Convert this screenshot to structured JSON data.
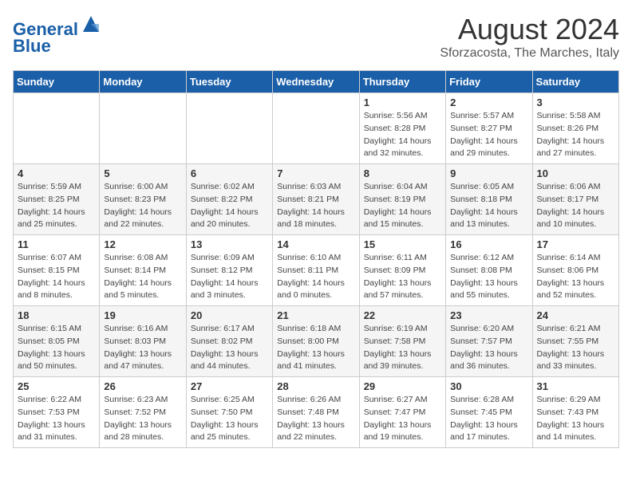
{
  "header": {
    "logo_line1": "General",
    "logo_line2": "Blue",
    "month": "August 2024",
    "location": "Sforzacosta, The Marches, Italy"
  },
  "weekdays": [
    "Sunday",
    "Monday",
    "Tuesday",
    "Wednesday",
    "Thursday",
    "Friday",
    "Saturday"
  ],
  "weeks": [
    [
      {
        "day": "",
        "info": ""
      },
      {
        "day": "",
        "info": ""
      },
      {
        "day": "",
        "info": ""
      },
      {
        "day": "",
        "info": ""
      },
      {
        "day": "1",
        "info": "Sunrise: 5:56 AM\nSunset: 8:28 PM\nDaylight: 14 hours\nand 32 minutes."
      },
      {
        "day": "2",
        "info": "Sunrise: 5:57 AM\nSunset: 8:27 PM\nDaylight: 14 hours\nand 29 minutes."
      },
      {
        "day": "3",
        "info": "Sunrise: 5:58 AM\nSunset: 8:26 PM\nDaylight: 14 hours\nand 27 minutes."
      }
    ],
    [
      {
        "day": "4",
        "info": "Sunrise: 5:59 AM\nSunset: 8:25 PM\nDaylight: 14 hours\nand 25 minutes."
      },
      {
        "day": "5",
        "info": "Sunrise: 6:00 AM\nSunset: 8:23 PM\nDaylight: 14 hours\nand 22 minutes."
      },
      {
        "day": "6",
        "info": "Sunrise: 6:02 AM\nSunset: 8:22 PM\nDaylight: 14 hours\nand 20 minutes."
      },
      {
        "day": "7",
        "info": "Sunrise: 6:03 AM\nSunset: 8:21 PM\nDaylight: 14 hours\nand 18 minutes."
      },
      {
        "day": "8",
        "info": "Sunrise: 6:04 AM\nSunset: 8:19 PM\nDaylight: 14 hours\nand 15 minutes."
      },
      {
        "day": "9",
        "info": "Sunrise: 6:05 AM\nSunset: 8:18 PM\nDaylight: 14 hours\nand 13 minutes."
      },
      {
        "day": "10",
        "info": "Sunrise: 6:06 AM\nSunset: 8:17 PM\nDaylight: 14 hours\nand 10 minutes."
      }
    ],
    [
      {
        "day": "11",
        "info": "Sunrise: 6:07 AM\nSunset: 8:15 PM\nDaylight: 14 hours\nand 8 minutes."
      },
      {
        "day": "12",
        "info": "Sunrise: 6:08 AM\nSunset: 8:14 PM\nDaylight: 14 hours\nand 5 minutes."
      },
      {
        "day": "13",
        "info": "Sunrise: 6:09 AM\nSunset: 8:12 PM\nDaylight: 14 hours\nand 3 minutes."
      },
      {
        "day": "14",
        "info": "Sunrise: 6:10 AM\nSunset: 8:11 PM\nDaylight: 14 hours\nand 0 minutes."
      },
      {
        "day": "15",
        "info": "Sunrise: 6:11 AM\nSunset: 8:09 PM\nDaylight: 13 hours\nand 57 minutes."
      },
      {
        "day": "16",
        "info": "Sunrise: 6:12 AM\nSunset: 8:08 PM\nDaylight: 13 hours\nand 55 minutes."
      },
      {
        "day": "17",
        "info": "Sunrise: 6:14 AM\nSunset: 8:06 PM\nDaylight: 13 hours\nand 52 minutes."
      }
    ],
    [
      {
        "day": "18",
        "info": "Sunrise: 6:15 AM\nSunset: 8:05 PM\nDaylight: 13 hours\nand 50 minutes."
      },
      {
        "day": "19",
        "info": "Sunrise: 6:16 AM\nSunset: 8:03 PM\nDaylight: 13 hours\nand 47 minutes."
      },
      {
        "day": "20",
        "info": "Sunrise: 6:17 AM\nSunset: 8:02 PM\nDaylight: 13 hours\nand 44 minutes."
      },
      {
        "day": "21",
        "info": "Sunrise: 6:18 AM\nSunset: 8:00 PM\nDaylight: 13 hours\nand 41 minutes."
      },
      {
        "day": "22",
        "info": "Sunrise: 6:19 AM\nSunset: 7:58 PM\nDaylight: 13 hours\nand 39 minutes."
      },
      {
        "day": "23",
        "info": "Sunrise: 6:20 AM\nSunset: 7:57 PM\nDaylight: 13 hours\nand 36 minutes."
      },
      {
        "day": "24",
        "info": "Sunrise: 6:21 AM\nSunset: 7:55 PM\nDaylight: 13 hours\nand 33 minutes."
      }
    ],
    [
      {
        "day": "25",
        "info": "Sunrise: 6:22 AM\nSunset: 7:53 PM\nDaylight: 13 hours\nand 31 minutes."
      },
      {
        "day": "26",
        "info": "Sunrise: 6:23 AM\nSunset: 7:52 PM\nDaylight: 13 hours\nand 28 minutes."
      },
      {
        "day": "27",
        "info": "Sunrise: 6:25 AM\nSunset: 7:50 PM\nDaylight: 13 hours\nand 25 minutes."
      },
      {
        "day": "28",
        "info": "Sunrise: 6:26 AM\nSunset: 7:48 PM\nDaylight: 13 hours\nand 22 minutes."
      },
      {
        "day": "29",
        "info": "Sunrise: 6:27 AM\nSunset: 7:47 PM\nDaylight: 13 hours\nand 19 minutes."
      },
      {
        "day": "30",
        "info": "Sunrise: 6:28 AM\nSunset: 7:45 PM\nDaylight: 13 hours\nand 17 minutes."
      },
      {
        "day": "31",
        "info": "Sunrise: 6:29 AM\nSunset: 7:43 PM\nDaylight: 13 hours\nand 14 minutes."
      }
    ]
  ]
}
